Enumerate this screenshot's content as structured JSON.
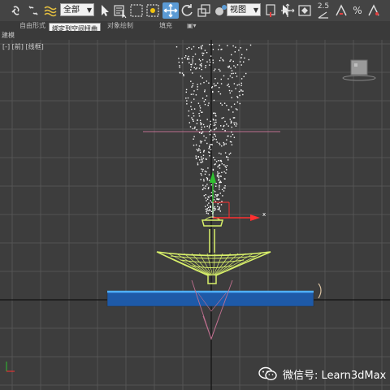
{
  "toolbar": {
    "selection_filter": "全部",
    "reference_coord": "视图",
    "snap_angle": "2.5",
    "icons": [
      "link-icon",
      "unlink-icon",
      "bind-spacewarp-icon",
      "select-icon",
      "select-by-name-icon",
      "rect-region-icon",
      "window-crossing-icon",
      "move-icon",
      "rotate-icon",
      "scale-icon",
      "pivot-icon",
      "mirror-icon",
      "align-icon",
      "snap-3d-icon",
      "angle-snap-icon",
      "percent-snap-icon",
      "spinner-snap-icon"
    ]
  },
  "tooltip": "绑定到空间扭曲",
  "ribbon": {
    "tabs": [
      "自由形式",
      "对象绘制",
      "填充"
    ]
  },
  "status": {
    "left_text": "建模"
  },
  "viewport": {
    "label_prefix": "[-] [前]",
    "label_mode": "[线框]",
    "grid_color": "#5a5a5a",
    "background": "#3d3d3d",
    "pool_color": "#1e5aa8",
    "pool_edge_color": "#4fb0ff",
    "fountain_color": "#d8f06a",
    "axis_x_color": "#ff3030",
    "axis_y_color": "#30c030",
    "gizmo_label_x": "x"
  },
  "watermark": {
    "text": "微信号: Learn3dMax"
  }
}
